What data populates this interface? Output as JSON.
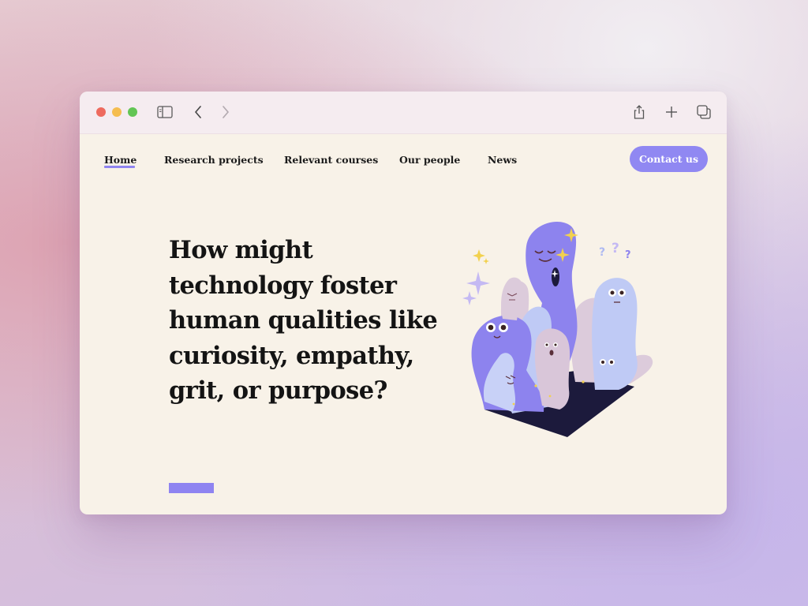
{
  "browser": {
    "traffic_lights": {
      "close_color": "#ee6a5e",
      "minimize_color": "#f5bd4f",
      "maximize_color": "#62c554"
    },
    "icons": [
      "sidebar-toggle-icon",
      "back-icon",
      "forward-icon",
      "share-icon",
      "plus-icon",
      "tabs-overview-icon"
    ]
  },
  "nav": {
    "items": [
      {
        "label": "Home",
        "active": true
      },
      {
        "label": "Research projects"
      },
      {
        "label": "Relevant courses"
      },
      {
        "label": "Our people"
      },
      {
        "label": "News"
      }
    ],
    "contact_label": "Contact us"
  },
  "hero": {
    "headline_lines": [
      "How might",
      "technology foster",
      "human qualities like",
      "curiosity, empathy,",
      "grit, or purpose?"
    ]
  },
  "colors": {
    "accent": "#8f84f1",
    "page_bg": "#f8f2e8",
    "text": "#141414",
    "lavender": "#8d83ee",
    "light_blue": "#bfcaf5",
    "mauve": "#dccbdb",
    "navy": "#1c1a3c"
  }
}
